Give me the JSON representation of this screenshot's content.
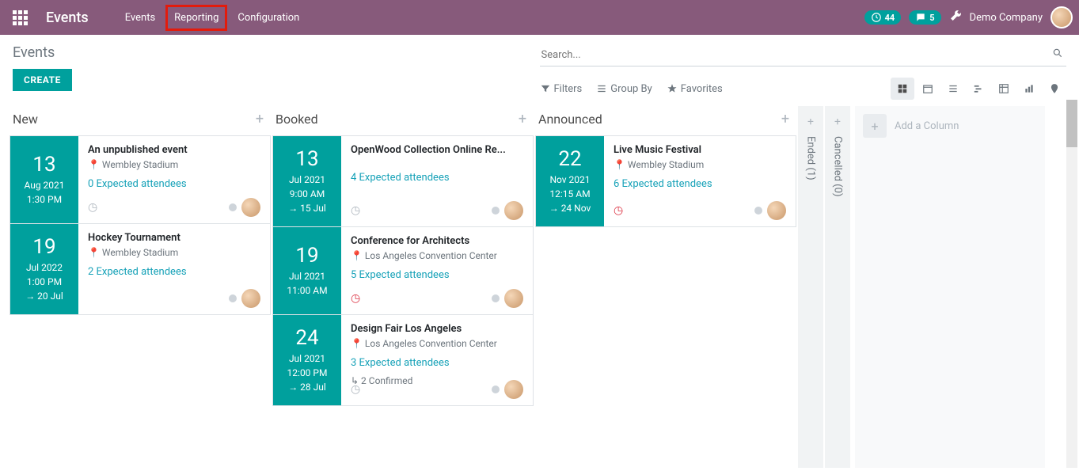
{
  "topbar": {
    "brand": "Events",
    "nav": {
      "events": "Events",
      "reporting": "Reporting",
      "configuration": "Configuration"
    },
    "badge1": "44",
    "badge2": "5",
    "company": "Demo Company"
  },
  "control": {
    "breadcrumb": "Events",
    "create": "CREATE",
    "search_placeholder": "Search...",
    "filters": "Filters",
    "groupby": "Group By",
    "favorites": "Favorites"
  },
  "columns": {
    "new": {
      "title": "New"
    },
    "booked": {
      "title": "Booked"
    },
    "announced": {
      "title": "Announced"
    },
    "ended": {
      "label": "Ended (1)"
    },
    "cancelled": {
      "label": "Cancelled (0)"
    },
    "add": {
      "label": "Add a Column"
    }
  },
  "cards": {
    "new1": {
      "day": "13",
      "month": "Aug 2021",
      "time": "1:30 PM",
      "title": "An unpublished event",
      "loc": "Wembley Stadium",
      "att": "0 Expected attendees"
    },
    "new2": {
      "day": "19",
      "month": "Jul 2022",
      "time": "1:00 PM",
      "end": "20 Jul",
      "title": "Hockey Tournament",
      "loc": "Wembley Stadium",
      "att": "2 Expected attendees"
    },
    "booked1": {
      "day": "13",
      "month": "Jul 2021",
      "time": "9:00 AM",
      "end": "15 Jul",
      "title": "OpenWood Collection Online Re...",
      "att": "4 Expected attendees"
    },
    "booked2": {
      "day": "19",
      "month": "Jul 2021",
      "time": "11:00 AM",
      "title": "Conference for Architects",
      "loc": "Los Angeles Convention Center",
      "att": "5 Expected attendees"
    },
    "booked3": {
      "day": "24",
      "month": "Jul 2021",
      "time": "12:00 PM",
      "end": "28 Jul",
      "title": "Design Fair Los Angeles",
      "loc": "Los Angeles Convention Center",
      "att": "3 Expected attendees",
      "conf": "2 Confirmed"
    },
    "ann1": {
      "day": "22",
      "month": "Nov 2021",
      "time": "12:15 AM",
      "end": "24 Nov",
      "title": "Live Music Festival",
      "loc": "Wembley Stadium",
      "att": "6 Expected attendees"
    }
  }
}
